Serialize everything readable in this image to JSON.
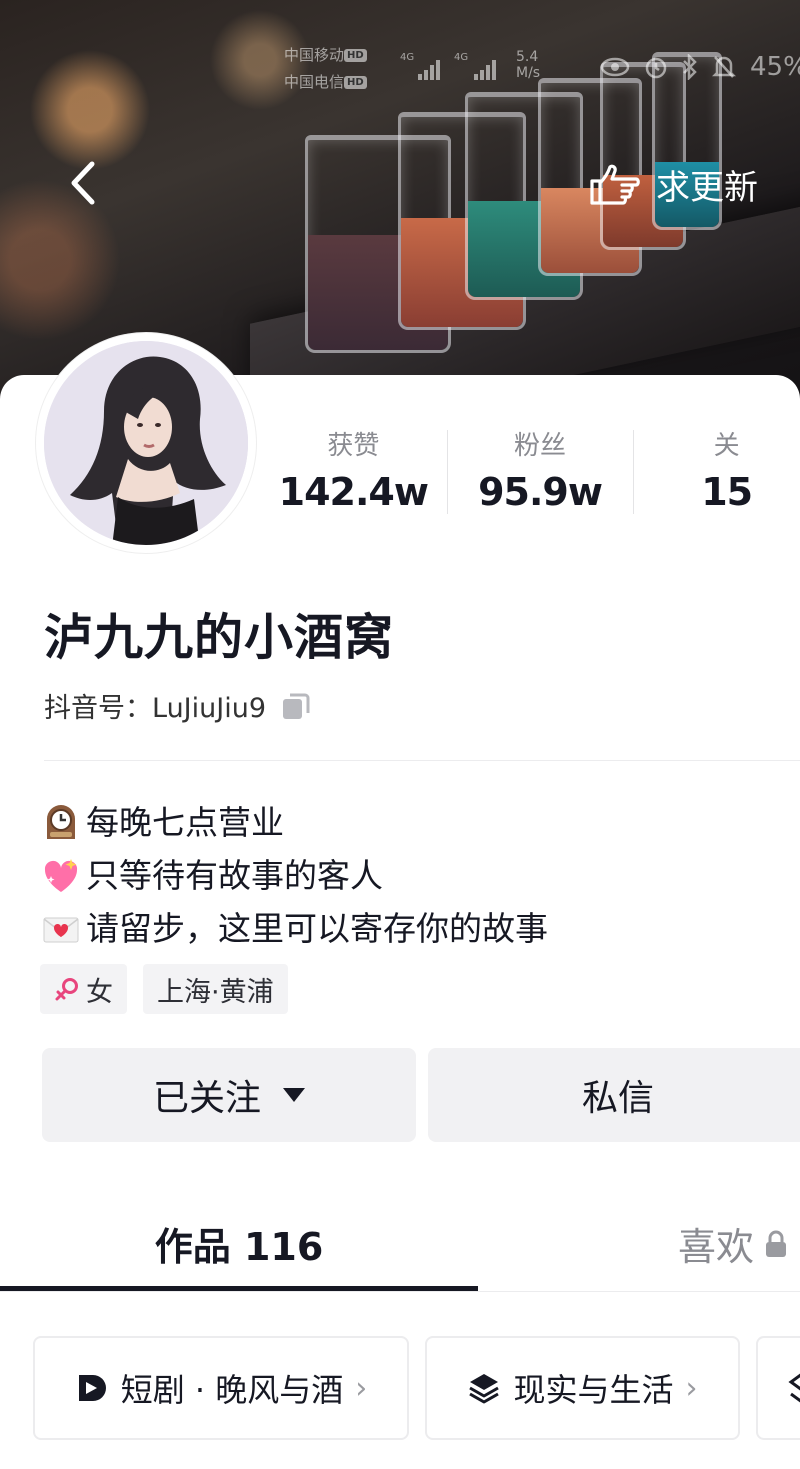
{
  "status_bar": {
    "carrier1": "中国移动",
    "carrier2": "中国电信",
    "hd": "HD",
    "network1": "4G",
    "network2": "4G",
    "speed_value": "5.4",
    "speed_unit": "M/s",
    "battery": "45%"
  },
  "header": {
    "update_label": "求更新"
  },
  "profile": {
    "name": "泸九九的小酒窝",
    "id_label": "抖音号：",
    "id_value": "LuJiuJiu9",
    "stats": [
      {
        "label": "获赞",
        "value": "142.4w"
      },
      {
        "label": "粉丝",
        "value": "95.9w"
      },
      {
        "label": "关",
        "value": "15"
      }
    ],
    "bio": [
      {
        "icon": "clock-emoji",
        "text": "每晚七点营业"
      },
      {
        "icon": "sparkling-heart-emoji",
        "text": "只等待有故事的客人"
      },
      {
        "icon": "love-letter-emoji",
        "text": "请留步，这里可以寄存你的故事"
      }
    ],
    "tags": {
      "gender_icon": "female-symbol-icon",
      "gender": "女",
      "location": "上海·黄浦"
    }
  },
  "actions": {
    "follow_label": "已关注",
    "message_label": "私信"
  },
  "tabs": {
    "works_label": "作品 116",
    "likes_label": "喜欢"
  },
  "collections": [
    {
      "icon": "short-drama-icon",
      "label": "短剧 · 晚风与酒"
    },
    {
      "icon": "layers-icon",
      "label": "现实与生活"
    }
  ],
  "colors": {
    "text_primary": "#161823",
    "text_secondary": "#8a8b91",
    "button_bg": "#f1f1f3",
    "gender_pink": "#e8457d"
  }
}
